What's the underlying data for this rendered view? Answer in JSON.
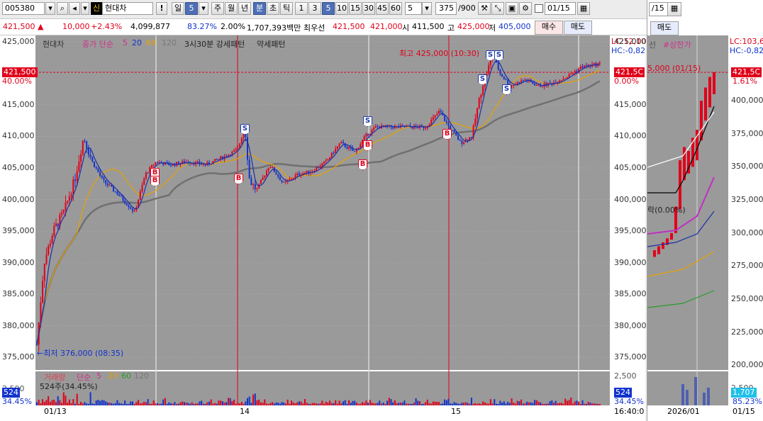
{
  "toolbar": {
    "code": "005380",
    "credit_badge": "신",
    "stock_name": "현대차",
    "warn": "!",
    "period_day": "일",
    "period_value": "5",
    "periods": [
      "주",
      "월",
      "년",
      "분",
      "초",
      "틱"
    ],
    "intervals": [
      "1",
      "3",
      "5",
      "10",
      "15",
      "30",
      "45",
      "60"
    ],
    "count_value": "5",
    "scroll_pos": "375",
    "scroll_total": "/900",
    "date_value": "01/15",
    "side_date": "/15"
  },
  "info": {
    "price": "421,500",
    "change": "10,000",
    "change_pct": "+2.43%",
    "volume": "4,099,877",
    "vol_ratio": "83.27%",
    "turnover_pct": "2.00%",
    "amount": "1,707,393백만",
    "best_label": "최우선",
    "ask": "421,500",
    "bid": "421,000",
    "open_label": "시",
    "open": "411,500",
    "high_label": "고",
    "high": "425,000",
    "low_label": "저",
    "low": "405,000",
    "sell_btn": "매수",
    "buy_btn": "매도",
    "side_btn": "매도"
  },
  "chart": {
    "legend_name": "현대차",
    "legend_ma": "종가 단순",
    "ma_periods": [
      "5",
      "20",
      "60",
      "120"
    ],
    "pattern_strong": "3시30분 강세패턴",
    "pattern_weak": "약세패턴",
    "lc": "LC:12,10",
    "hc": "HC:-0,82",
    "cur_price_tag": "421,500",
    "cur_pct_tag": "40.00%",
    "right_price_tag": "421,5C",
    "right_pct_tag": "0.00%",
    "high_note": "최고 425,000 (10:30)",
    "low_note": "←최저 376,000 (08:35)",
    "vol_legend_name": "거래량",
    "vol_legend_ma": "단순",
    "vol_periods": [
      "5",
      "20",
      "60",
      "120"
    ],
    "vol_shares": "524주(34.45%)",
    "vol_tag_left": "524",
    "vol_pct_left": "34.45%",
    "vol_tag_right": "524",
    "vol_pct_right": "34.45%",
    "vol_max": "2,500",
    "date_labels": [
      "01/13",
      "14",
      "15"
    ],
    "end_time": "16:40:0",
    "y_ticks": [
      "425,000",
      "415,000",
      "410,000",
      "405,000",
      "400,000",
      "395,000",
      "390,000",
      "385,000",
      "380,000",
      "375,000"
    ]
  },
  "side": {
    "lc": "LC:103,6",
    "hc": "HC:-0,82",
    "legend": "선",
    "legend_limit": "#상한가",
    "price_tag": "421,5C",
    "pct_tag": "1.61%",
    "note": "5,000 (01/15)",
    "low_note": "락(0.00%)",
    "y_ticks": [
      "400,000",
      "375,000",
      "350,000",
      "325,000",
      "300,000",
      "275,000",
      "250,000",
      "225,000",
      "200,000"
    ],
    "vol_tick": "2,500",
    "vol_tag": "1,707",
    "vol_pct": "85.23%",
    "date_label": "2026/01",
    "date_right": "01/15"
  },
  "chart_data": {
    "type": "candlestick",
    "x": [
      "01/13",
      "14",
      "15"
    ],
    "series": [
      {
        "name": "현대차",
        "values": [
          376000,
          413000,
          404000,
          408000,
          411500,
          425000,
          421500
        ]
      }
    ],
    "high": 425000,
    "low": 376000,
    "ylim": [
      373000,
      426000
    ]
  },
  "colors": {
    "up": "#e0001a",
    "down": "#1233cc",
    "bg": "#999999",
    "ma5": "#1b2fa8",
    "ma20": "#e8a000",
    "ma60": "#7a7a7a"
  }
}
